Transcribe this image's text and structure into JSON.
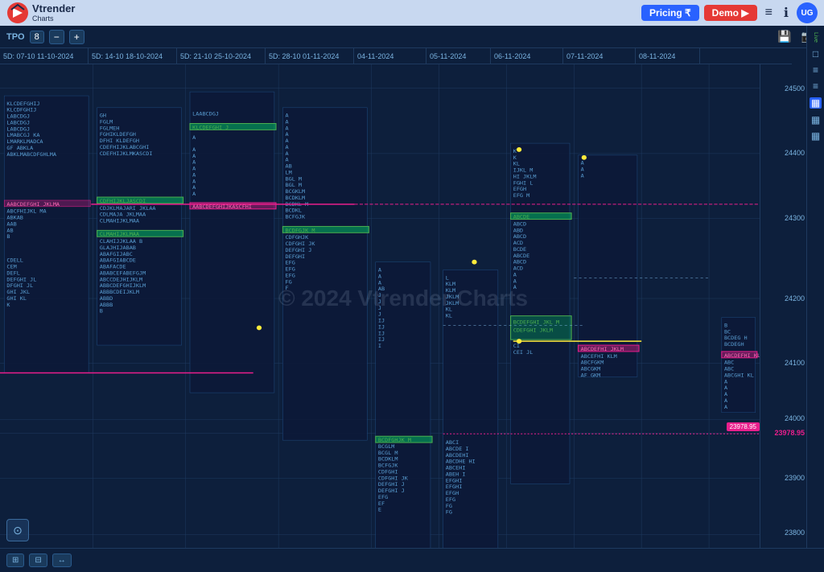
{
  "navbar": {
    "logo_text": "Vtrender",
    "logo_sub": "Charts",
    "pricing_label": "Pricing ₹",
    "demo_label": "Demo ▶",
    "user_initials": "UG"
  },
  "toolbar": {
    "tpo_label": "TPO",
    "tpo_value": "8",
    "minus_label": "−",
    "plus_label": "+"
  },
  "dates": [
    {
      "label": "5D: 07-10  11-10-2024"
    },
    {
      "label": "5D: 14-10  18-10-2024"
    },
    {
      "label": "5D: 21-10  25-10-2024"
    },
    {
      "label": "5D: 28-10  01-11-2024"
    },
    {
      "label": "04-11-2024"
    },
    {
      "label": "05-11-2024"
    },
    {
      "label": "06-11-2024"
    },
    {
      "label": "07-11-2024"
    },
    {
      "label": "08-11-2024"
    }
  ],
  "prices": [
    {
      "value": "24500",
      "pct": 8
    },
    {
      "value": "24400",
      "pct": 21
    },
    {
      "value": "24300",
      "pct": 34
    },
    {
      "value": "24200",
      "pct": 50
    },
    {
      "value": "24100",
      "pct": 63
    },
    {
      "value": "24000",
      "pct": 75
    },
    {
      "value": "23978.95",
      "pct": 77
    },
    {
      "value": "23900",
      "pct": 86
    },
    {
      "value": "23800",
      "pct": 98
    }
  ],
  "watermark": "© 2024 Vtrender Charts",
  "price_tag": "23978.95",
  "live_label": "Live",
  "bottom_tools": [
    "⊞",
    "⊟",
    "↔"
  ],
  "right_sidebar_icons": [
    "□",
    "≡",
    "≡",
    "▦",
    "▦",
    "▦"
  ],
  "focus_icon": "⊙"
}
